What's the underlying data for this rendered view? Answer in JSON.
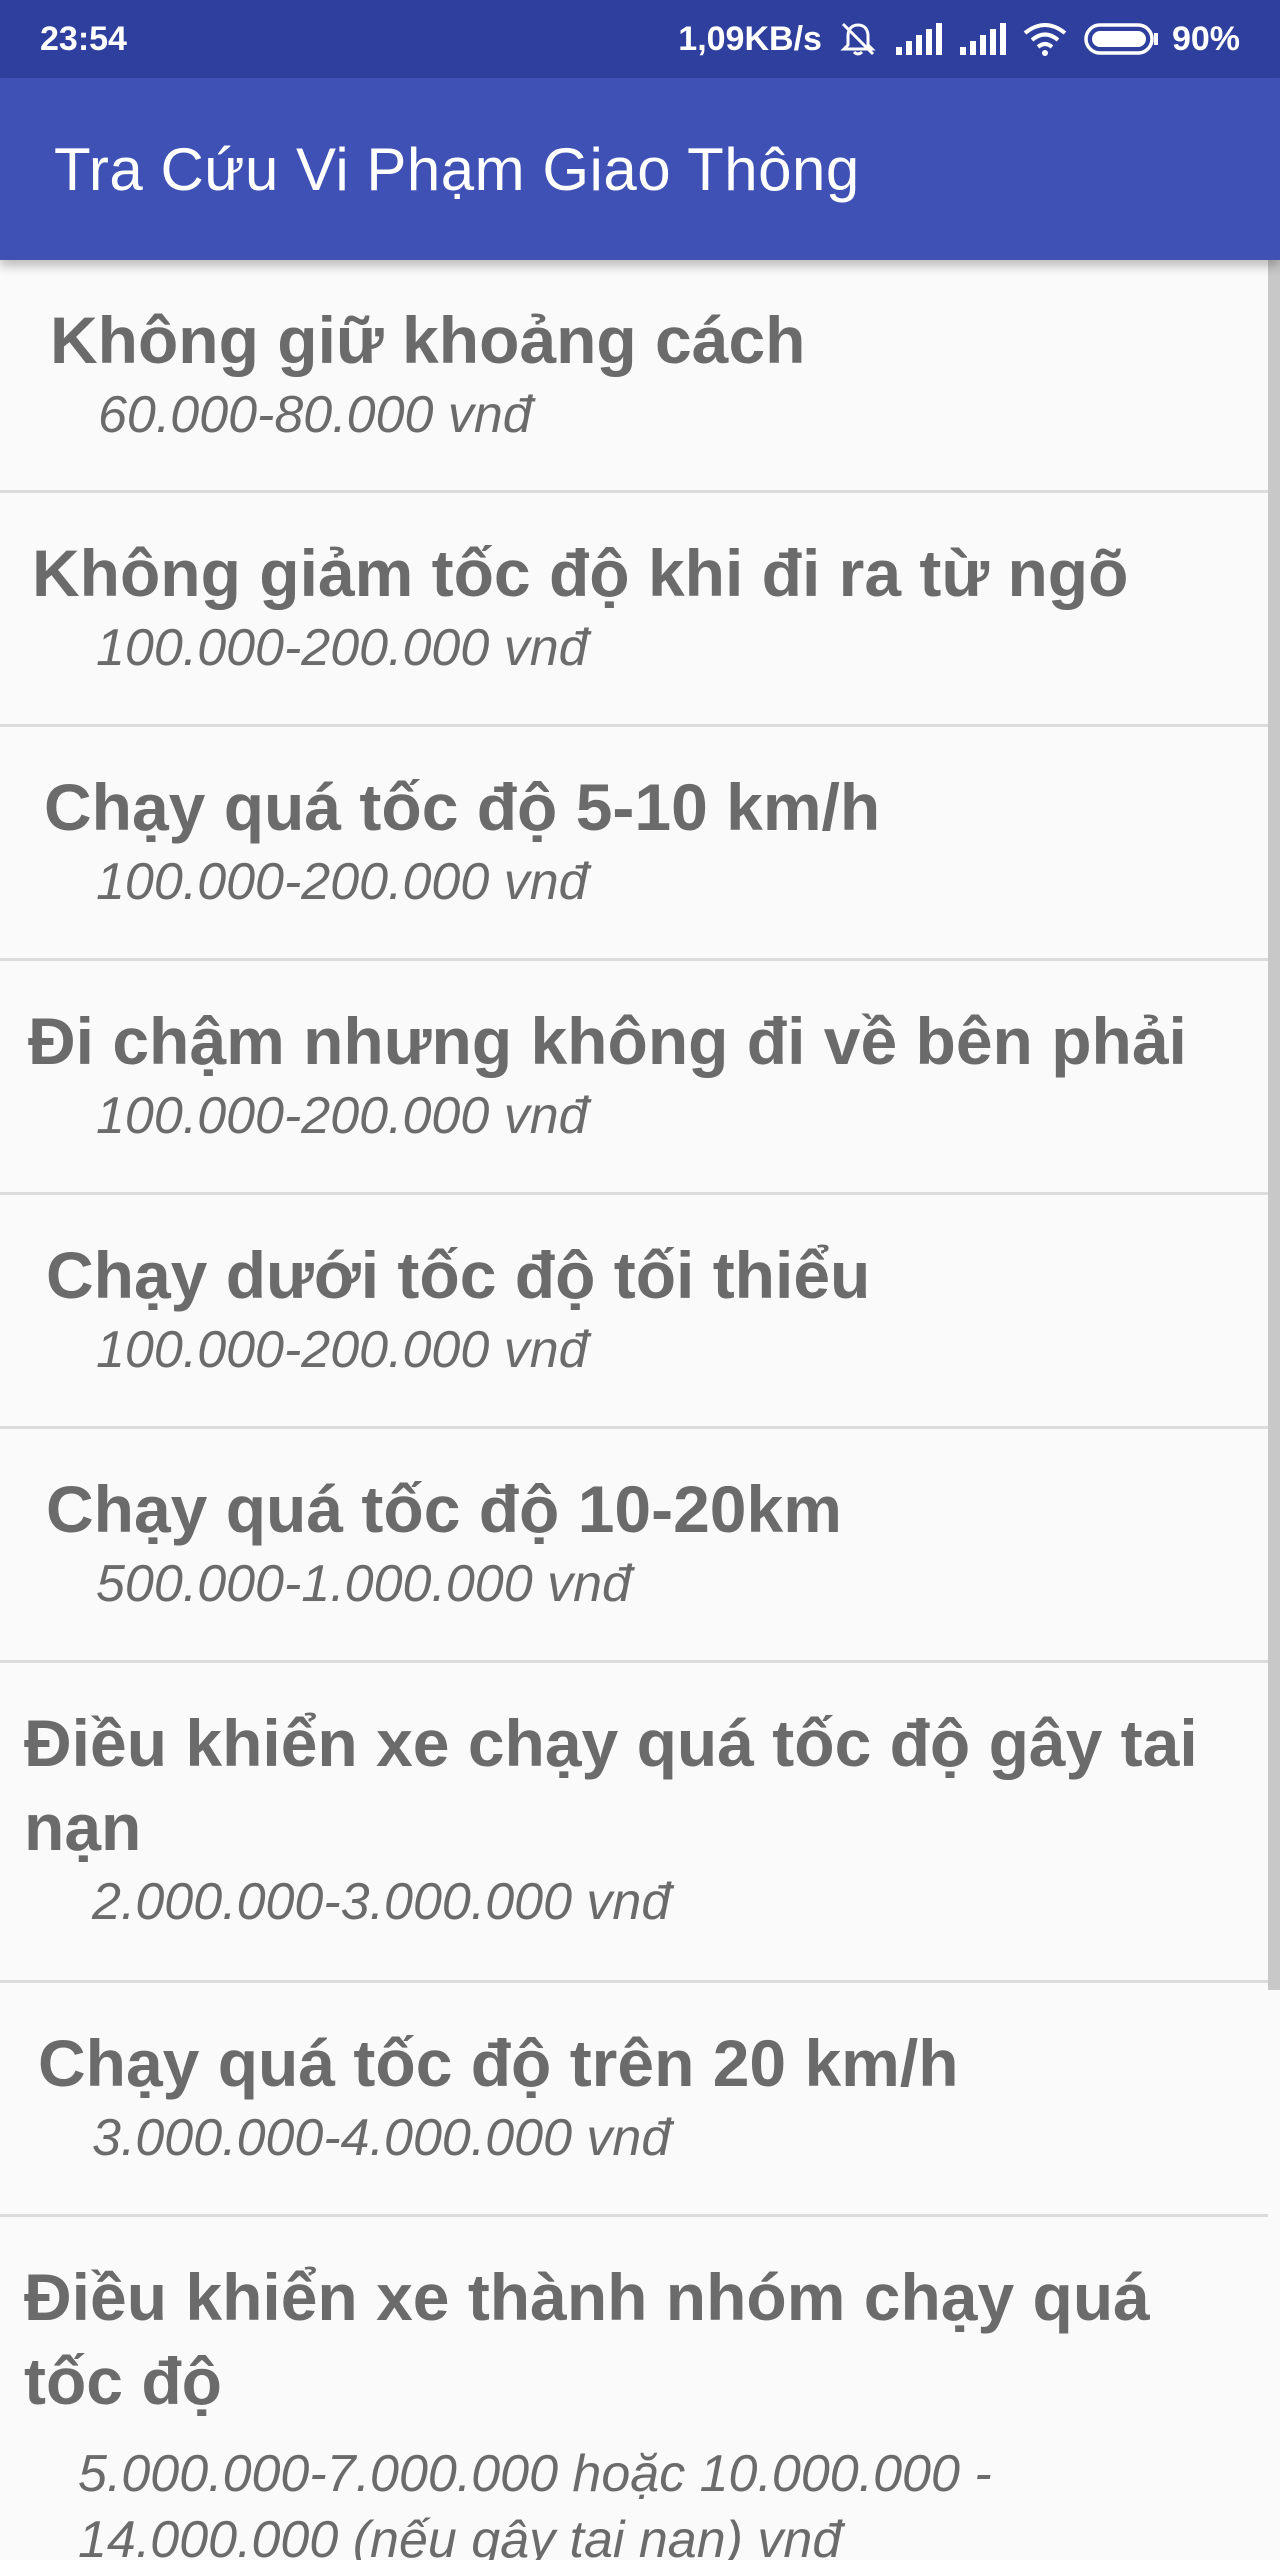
{
  "status_bar": {
    "time": "23:54",
    "network_speed": "1,09KB/s",
    "battery_percent": "90%",
    "icons": [
      "alarm-off-icon",
      "signal-icon",
      "signal-icon",
      "wifi-icon",
      "battery-icon"
    ]
  },
  "app_bar": {
    "title": "Tra Cứu Vi Phạm Giao Thông"
  },
  "colors": {
    "status_bar": "#2f3f9e",
    "app_bar": "#3f51b5",
    "text": "#6b6b6b",
    "divider": "#dcdcdc",
    "background": "#fafafa"
  },
  "violations": [
    {
      "title": "Không giữ khoảng cách",
      "fine": "60.000-80.000 vnđ"
    },
    {
      "title": "Không giảm tốc độ khi đi ra từ ngõ",
      "fine": "100.000-200.000 vnđ"
    },
    {
      "title": "Chạy quá tốc độ 5-10 km/h",
      "fine": "100.000-200.000 vnđ"
    },
    {
      "title": "Đi chậm nhưng không đi về bên phải",
      "fine": "100.000-200.000 vnđ"
    },
    {
      "title": "Chạy dưới tốc độ tối thiểu",
      "fine": "100.000-200.000 vnđ"
    },
    {
      "title": "Chạy quá tốc độ 10-20km",
      "fine": "500.000-1.000.000 vnđ"
    },
    {
      "title": "Điều khiển xe chạy quá tốc độ gây tai nạn",
      "fine": "2.000.000-3.000.000 vnđ"
    },
    {
      "title": "Chạy quá tốc độ trên 20 km/h",
      "fine": "3.000.000-4.000.000 vnđ"
    },
    {
      "title": "Điều khiển xe thành nhóm chạy quá tốc độ",
      "fine": "5.000.000-7.000.000 hoặc 10.000.000 - 14.000.000 (nếu gây tai nạn) vnđ"
    }
  ]
}
